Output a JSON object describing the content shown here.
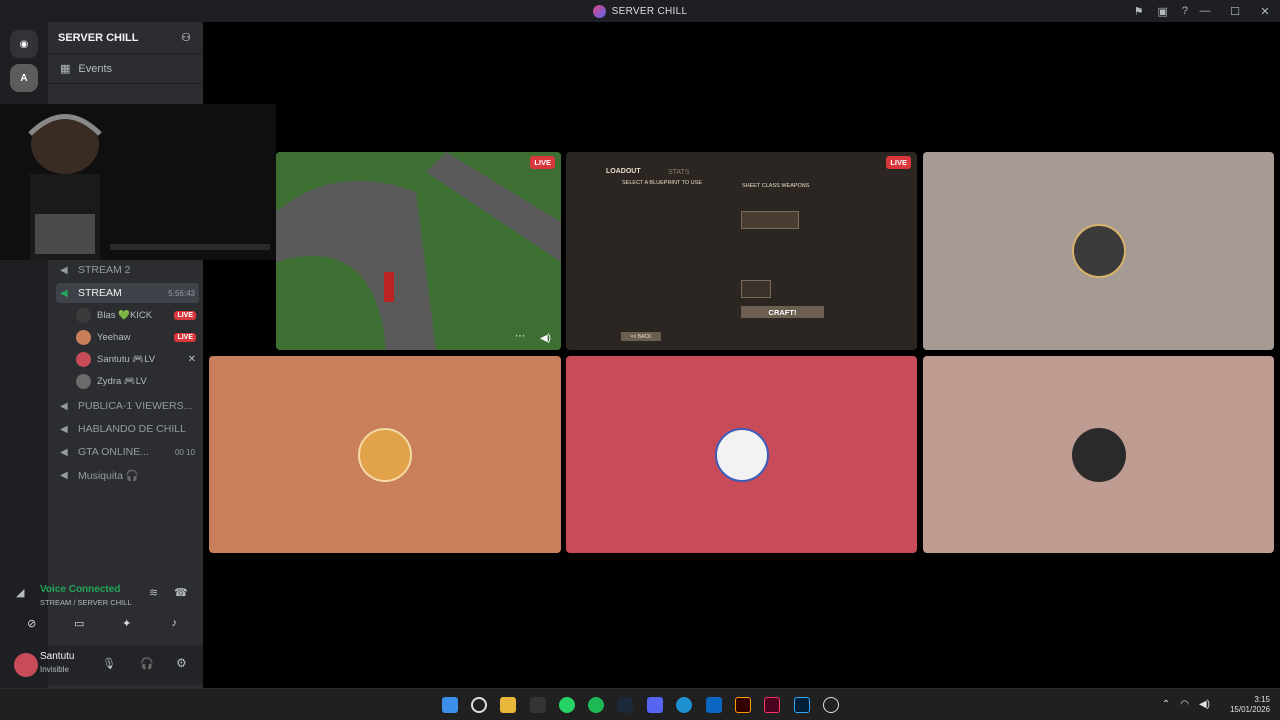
{
  "window": {
    "title": "SERVER CHILL",
    "controls": [
      "—",
      "☐",
      "✕"
    ],
    "toolbar_icons": [
      "inbox-icon",
      "window-icon",
      "help-icon"
    ]
  },
  "server": {
    "name": "SERVER CHILL",
    "events_label": "Events"
  },
  "channels": [
    {
      "name": "STREAM 2",
      "meta": ""
    },
    {
      "name": "STREAM",
      "meta": "5:56:43",
      "active": true
    },
    {
      "name": "PUBLICA-1 VIEWERS...",
      "meta": ""
    },
    {
      "name": "HABLANDO DE CHILL",
      "meta": ""
    },
    {
      "name": "GTA ONLINE...",
      "meta": "00 10"
    },
    {
      "name": "Musiquita 🎧",
      "meta": ""
    }
  ],
  "stream_users": [
    {
      "name": "Blas 💚KICK",
      "badge": "LIVE"
    },
    {
      "name": "Yeehaw",
      "badge": "LIVE"
    },
    {
      "name": "Santutu 🎮LV",
      "badge": ""
    },
    {
      "name": "Zydra 🎮LV",
      "badge": ""
    }
  ],
  "voice": {
    "status": "Voice Connected",
    "location": "STREAM / SERVER CHILL"
  },
  "account": {
    "name": "Santutu",
    "status": "Invisible"
  },
  "tiles": {
    "live_label": "LIVE",
    "game": {
      "tab_loadout": "LOADOUT",
      "tab_stats": "STATS",
      "blueprint_label": "SELECT A BLUEPRINT TO USE",
      "weapons_label": "SHEET CLASS WEAPONS",
      "craft_button": "CRAFT!",
      "back_button": "<< BACK"
    }
  },
  "clock": {
    "time": "3:15",
    "date": "15/01/2026"
  },
  "colors": {
    "tile_orange": "#c97f5b",
    "tile_red": "#c84b5a",
    "tile_pink": "#bf9c92",
    "tile_gray": "#a59b94",
    "live_red": "#da373c",
    "voice_green": "#23a55a"
  }
}
